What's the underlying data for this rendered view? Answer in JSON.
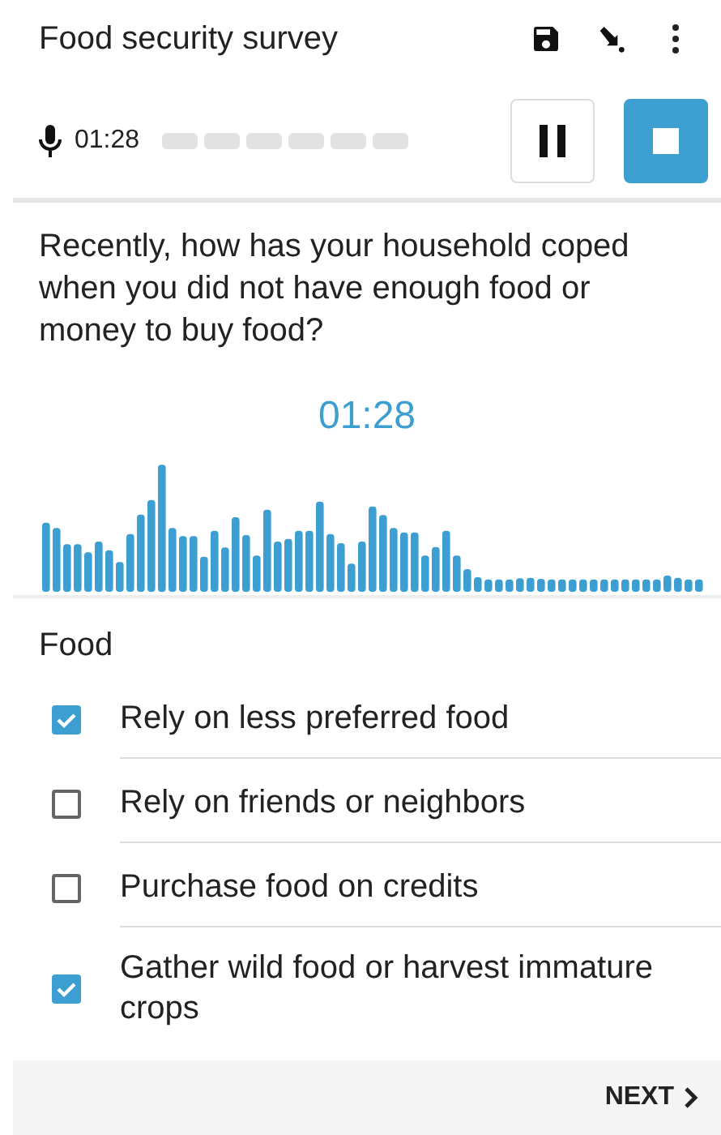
{
  "app_bar": {
    "title": "Food security survey"
  },
  "recorder": {
    "elapsed": "01:28",
    "paused": false
  },
  "question": {
    "text": "Recently, how has your household coped when you did not have enough food or money to buy food?",
    "timer": "01:28"
  },
  "section": {
    "title": "Food"
  },
  "options": [
    {
      "label": "Rely on less preferred food",
      "checked": true
    },
    {
      "label": "Rely on friends or neighbors",
      "checked": false
    },
    {
      "label": "Purchase food on credits",
      "checked": false
    },
    {
      "label": "Gather wild food or harvest immature crops",
      "checked": true
    }
  ],
  "footer": {
    "next": "NEXT"
  }
}
